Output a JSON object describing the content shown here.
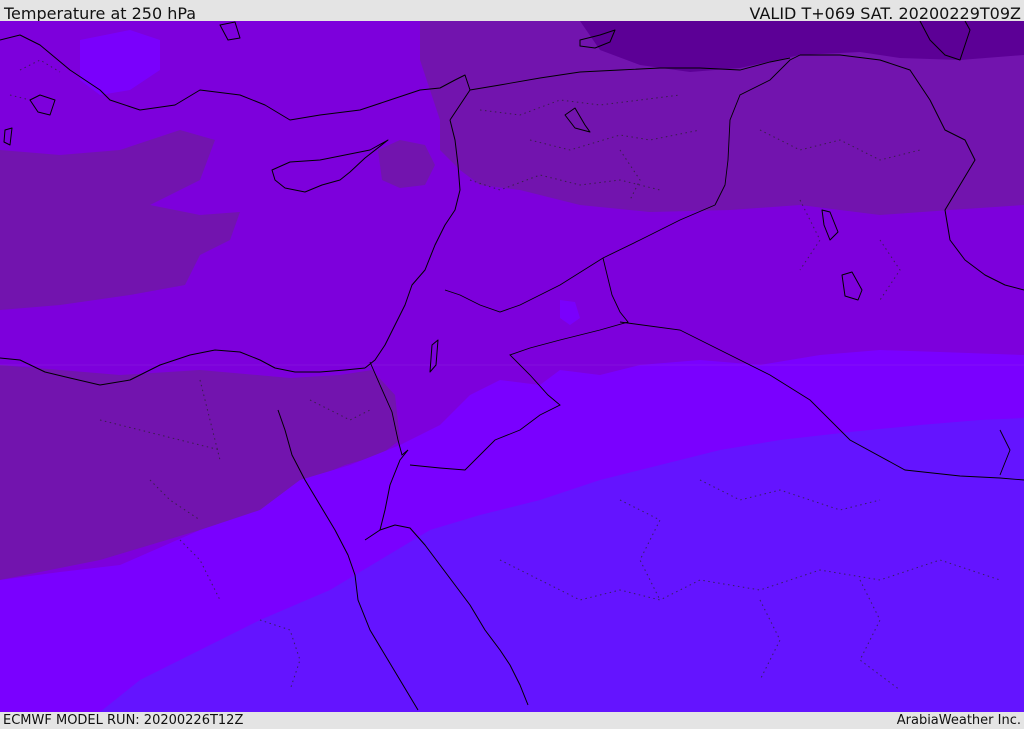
{
  "header": {
    "title": "Temperature at 250 hPa",
    "valid": "VALID T+069 SAT. 20200229T09Z"
  },
  "footer": {
    "model_run": "ECMWF MODEL RUN: 20200226T12Z",
    "credit": "ArabiaWeather Inc."
  },
  "map": {
    "field": "temperature",
    "level": "250 hPa",
    "palette": {
      "coldest": "#5c0096",
      "cold": "#7214ae",
      "mid": "#7d00dc",
      "mid_cool": "#7e00f0",
      "warm": "#7a00ff",
      "warmest": "#6414ff",
      "coastline": "#000000"
    }
  }
}
